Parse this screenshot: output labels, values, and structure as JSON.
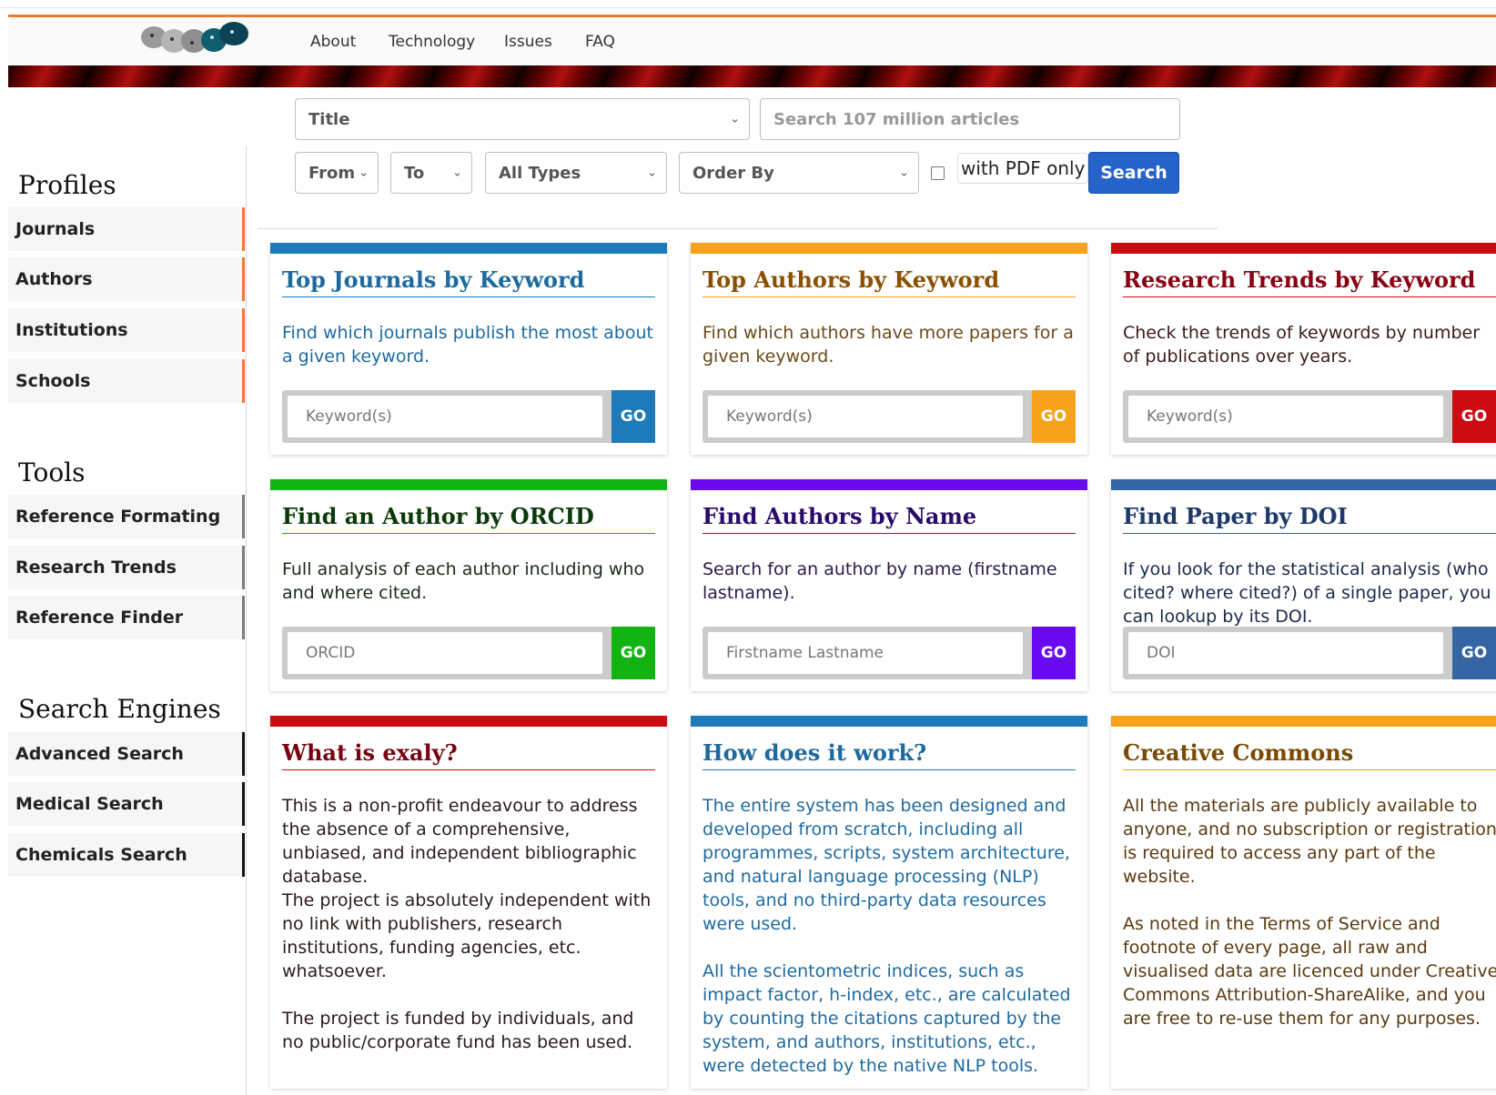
{
  "nav": {
    "links": [
      "About",
      "Technology",
      "Issues",
      "FAQ"
    ]
  },
  "search": {
    "field_select": "Title",
    "query_placeholder": "Search 107 million articles",
    "from": "From",
    "to": "To",
    "type": "All Types",
    "order": "Order By",
    "pdf_label": "with PDF only",
    "button": "Search"
  },
  "sidebar": {
    "profiles_heading": "Profiles",
    "profiles": [
      "Journals",
      "Authors",
      "Institutions",
      "Schools"
    ],
    "tools_heading": "Tools",
    "tools": [
      "Reference Formating",
      "Research Trends",
      "Reference Finder"
    ],
    "engines_heading": "Search Engines",
    "engines": [
      "Advanced Search",
      "Medical Search",
      "Chemicals Search"
    ]
  },
  "cards": {
    "journals": {
      "title": "Top Journals by Keyword",
      "desc": "Find which journals publish the most about a given keyword.",
      "placeholder": "Keyword(s)",
      "go": "GO",
      "color": "#1e7ab8"
    },
    "authors": {
      "title": "Top Authors by Keyword",
      "desc": "Find which authors have more papers for a given keyword.",
      "placeholder": "Keyword(s)",
      "go": "GO",
      "color": "#f7a21b"
    },
    "trends": {
      "title": "Research Trends by Keyword",
      "desc": "Check the trends of keywords by number of publications over years.",
      "placeholder": "Keyword(s)",
      "go": "GO",
      "color": "#cc0a12"
    },
    "orcid": {
      "title": "Find an Author by ORCID",
      "desc": "Full analysis of each author including who and where cited.",
      "placeholder": "ORCID",
      "go": "GO",
      "color": "#12b312"
    },
    "byname": {
      "title": "Find Authors by Name",
      "desc": "Search for an author by name (firstname lastname).",
      "placeholder": "Firstname Lastname",
      "go": "GO",
      "color": "#6a0af0"
    },
    "doi": {
      "title": "Find Paper by DOI",
      "desc": "If you look for the statistical analysis (who cited? where cited?) of a single paper, you can lookup by its DOI.",
      "placeholder": "DOI",
      "go": "GO",
      "color": "#3566a3"
    },
    "what": {
      "title": "What is exaly?",
      "p1": "This is a non-profit endeavour to address the absence of a comprehensive, unbiased, and independent bibliographic database.",
      "p2": "The project is absolutely independent with no link with publishers, research institutions, funding agencies, etc. whatsoever.",
      "p3": "The project is funded by individuals, and no public/corporate fund has been used.",
      "color": "#cc0a12"
    },
    "how": {
      "title": "How does it work?",
      "p1": "The entire system has been designed and developed from scratch, including all programmes, scripts, system architecture, and natural language processing (NLP) tools, and no third-party data resources were used.",
      "p2": "All the scientometric indices, such as impact factor, h-index, etc., are calculated by counting the citations captured by the system, and authors, institutions, etc., were detected by the native NLP tools.",
      "color": "#1e7ab8"
    },
    "cc": {
      "title": "Creative Commons",
      "p1": "All the materials are publicly available to anyone, and no subscription or registration is required to access any part of the website.",
      "p2": "As noted in the Terms of Service and footnote of every page, all raw and visualised data are licenced under Creative Commons Attribution-ShareAlike, and you are free to re-use them for any purposes.",
      "color": "#f7a21b"
    }
  }
}
